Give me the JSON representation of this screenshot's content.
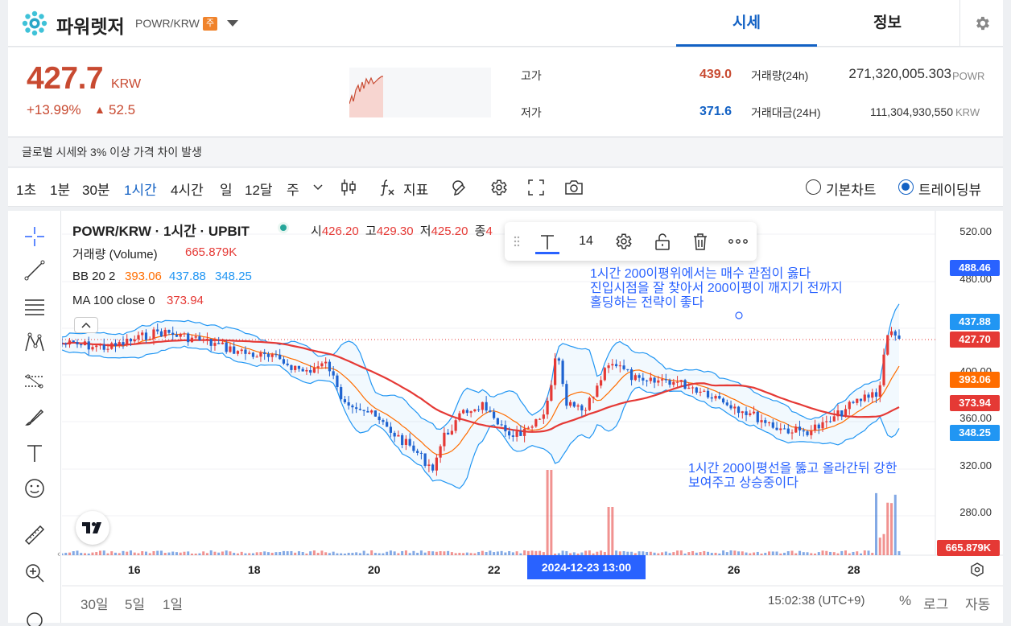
{
  "header": {
    "coin_name": "파워렛저",
    "pair": "POWR/KRW",
    "badge": "주",
    "tabs": [
      {
        "label": "시세",
        "active": true
      },
      {
        "label": "정보",
        "active": false
      }
    ]
  },
  "price": {
    "current": "427.7",
    "unit": "KRW",
    "change_rate": "+13.99%",
    "change_arrow": "▲",
    "change_abs": "52.5",
    "high_label": "고가",
    "high_value": "439.0",
    "low_label": "저가",
    "low_value": "371.6",
    "volume_label": "거래량(24h)",
    "volume_value": "271,320,005.303",
    "volume_unit": "POWR",
    "amount_label": "거래대금(24H)",
    "amount_value": "111,304,930,550",
    "amount_unit": "KRW"
  },
  "notice": {
    "text": "글로벌 시세와 3% 이상 가격 차이 발생"
  },
  "toolbar": {
    "timeframes": [
      {
        "label": "1초",
        "active": false
      },
      {
        "label": "1분",
        "active": false
      },
      {
        "label": "30분",
        "active": false
      },
      {
        "label": "1시간",
        "active": true
      },
      {
        "label": "4시간",
        "active": false
      },
      {
        "label": "일",
        "active": false
      },
      {
        "label": "12달",
        "active": false
      },
      {
        "label": "주",
        "active": false
      }
    ],
    "indicator_label": "지표",
    "view_basic": "기본차트",
    "view_trading": "트레이딩뷰",
    "selected_view": "트레이딩뷰"
  },
  "legend": {
    "title": "POWR/KRW · 1시간 · UPBIT",
    "ohlc": [
      {
        "k": "시",
        "v": "426.20"
      },
      {
        "k": "고",
        "v": "429.30"
      },
      {
        "k": "저",
        "v": "425.20"
      },
      {
        "k": "종",
        "v": "4"
      }
    ],
    "volume_label": "거래량 (Volume)",
    "volume_value": "665.879K",
    "bb_label": "BB 20 2",
    "bb_basis": "393.06",
    "bb_upper": "437.88",
    "bb_lower": "348.25",
    "ma_label": "MA 100 close 0",
    "ma_value": "373.94"
  },
  "float_toolbar": {
    "font_size": "14"
  },
  "annotations": [
    "1시간 200이평위에서는 매수 관점이 옳다",
    "진입시점을 잘 찾아서 200이평이 깨지기 전까지",
    "홀딩하는 전략이 좋다",
    "1시간 200이평선을 뚫고 올라간뒤 강한",
    "보여주고 상승중이다"
  ],
  "price_axis": {
    "ticks": [
      "520.00",
      "480.00",
      "400.00",
      "360.00",
      "320.00",
      "280.00"
    ],
    "badges": [
      {
        "label": "488.46",
        "color": "#2962ff"
      },
      {
        "label": "437.88",
        "color": "#2196f3"
      },
      {
        "label": "427.70",
        "color": "#e53935"
      },
      {
        "label": "393.06",
        "color": "#ff6d00"
      },
      {
        "label": "373.94",
        "color": "#e53935"
      },
      {
        "label": "348.25",
        "color": "#2196f3"
      },
      {
        "label": "665.879K",
        "color": "#e53935"
      }
    ]
  },
  "time_axis": {
    "ticks": [
      "16",
      "18",
      "20",
      "22",
      "26",
      "28"
    ],
    "cursor_label": "2024-12-23   13:00"
  },
  "bottom_bar": {
    "ranges": [
      "30일",
      "5일",
      "1일"
    ],
    "clock": "15:02:38 (UTC+9)",
    "percent": "%",
    "log": "로그",
    "auto": "자동"
  },
  "colors": {
    "up": "#c84a31",
    "down": "#1261c4",
    "candle_up": "#e53935",
    "candle_down": "#1e63d0",
    "bb_band": "#2196f3",
    "bb_basis": "#ff6d00",
    "ma": "#e53935",
    "annotation": "#2962ff"
  },
  "icons": [
    "logo-icon",
    "chevron-down-icon",
    "gear-icon",
    "candle-type-icon",
    "fx-icon",
    "drawing-pen-icon",
    "fullscreen-icon",
    "camera-icon",
    "crosshair-icon",
    "trendline-icon",
    "fib-icon",
    "pattern-icon",
    "forecast-icon",
    "brush-icon",
    "text-icon",
    "emoji-icon",
    "ruler-icon",
    "zoom-in-icon",
    "grip-icon",
    "lock-icon",
    "trash-icon",
    "more-icon",
    "tradingview-logo-icon",
    "chevron-up-icon"
  ]
}
